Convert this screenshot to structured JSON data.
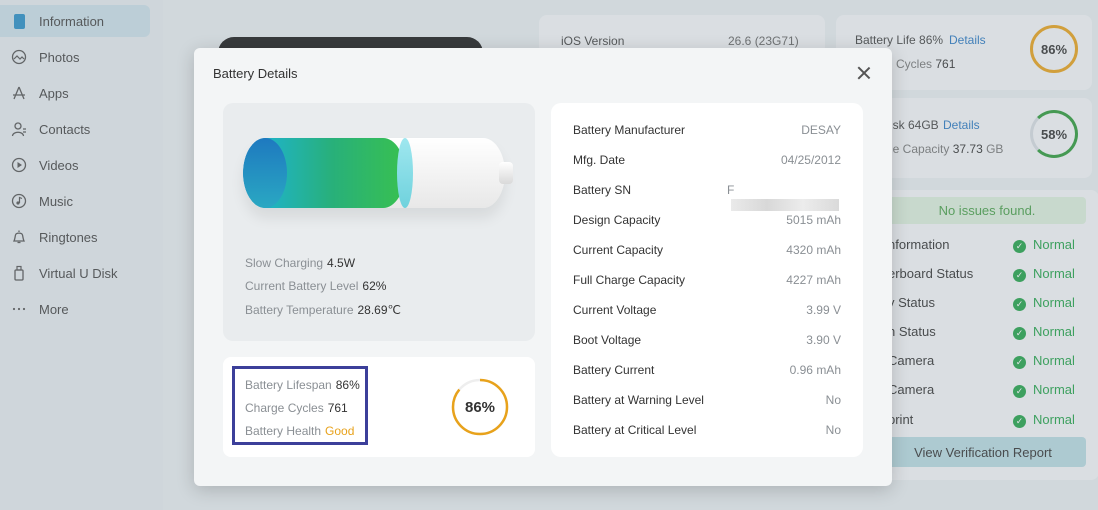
{
  "sidebar": {
    "items": [
      {
        "label": "Information",
        "icon": "phone-icon"
      },
      {
        "label": "Photos",
        "icon": "image-icon"
      },
      {
        "label": "Apps",
        "icon": "apps-icon"
      },
      {
        "label": "Contacts",
        "icon": "contact-icon"
      },
      {
        "label": "Videos",
        "icon": "play-icon"
      },
      {
        "label": "Music",
        "icon": "music-icon"
      },
      {
        "label": "Ringtones",
        "icon": "bell-icon"
      },
      {
        "label": "Virtual U Disk",
        "icon": "usb-icon"
      },
      {
        "label": "More",
        "icon": "more-icon"
      }
    ],
    "active": "Information"
  },
  "background": {
    "ios_version_label": "iOS Version",
    "ios_version_value": "26.6 (23G71)",
    "battery_life_label": "Battery Life",
    "battery_life_value": "86%",
    "battery_details_link": "Details",
    "cycles_partial": "Cycles",
    "cycles_value": "761",
    "battery_ring": "86%",
    "disk_partial": "isk 64GB",
    "disk_details_link": "Details",
    "capacity_partial": "le Capacity",
    "capacity_value": "37.73",
    "capacity_unit": "GB",
    "disk_ring": "58%",
    "no_issues": "No issues found.",
    "checks": [
      {
        "label": "nformation",
        "status": "Normal"
      },
      {
        "label": "erboard Status",
        "status": "Normal"
      },
      {
        "label": "y Status",
        "status": "Normal"
      },
      {
        "label": "n Status",
        "status": "Normal"
      },
      {
        "label": "Camera",
        "status": "Normal"
      },
      {
        "label": "Camera",
        "status": "Normal"
      },
      {
        "label": "print",
        "status": "Normal"
      }
    ],
    "verify_button": "View Verification Report"
  },
  "modal": {
    "title": "Battery Details",
    "battery_fill_level": 0.62,
    "charging": [
      {
        "label": "Slow Charging",
        "value": "4.5W"
      },
      {
        "label": "Current Battery Level",
        "value": "62%"
      },
      {
        "label": "Battery Temperature",
        "value": "28.69℃"
      }
    ],
    "life": [
      {
        "label": "Battery Lifespan",
        "value": "86%"
      },
      {
        "label": "Charge Cycles",
        "value": "761"
      },
      {
        "label": "Battery Health",
        "value": "Good"
      }
    ],
    "life_ring_text": "86%",
    "life_ring_fraction": 0.86,
    "details": [
      {
        "label": "Battery Manufacturer",
        "value": "DESAY"
      },
      {
        "label": "Mfg. Date",
        "value": "04/25/2012"
      },
      {
        "label": "Battery SN",
        "value": "F"
      },
      {
        "label": "Design Capacity",
        "value": "5015 mAh"
      },
      {
        "label": "Current Capacity",
        "value": "4320 mAh"
      },
      {
        "label": "Full Charge Capacity",
        "value": "4227 mAh"
      },
      {
        "label": "Current Voltage",
        "value": "3.99 V"
      },
      {
        "label": "Boot Voltage",
        "value": "3.90 V"
      },
      {
        "label": "Battery Current",
        "value": "0.96 mAh"
      },
      {
        "label": "Battery at Warning Level",
        "value": "No"
      },
      {
        "label": "Battery at Critical Level",
        "value": "No"
      }
    ]
  },
  "colors": {
    "accent": "#2a78c2",
    "ok_green": "#23a34a",
    "ring_orange": "#e8a21b",
    "ring_green": "#2e9a3a",
    "highlight_border": "#3c3f9a"
  }
}
